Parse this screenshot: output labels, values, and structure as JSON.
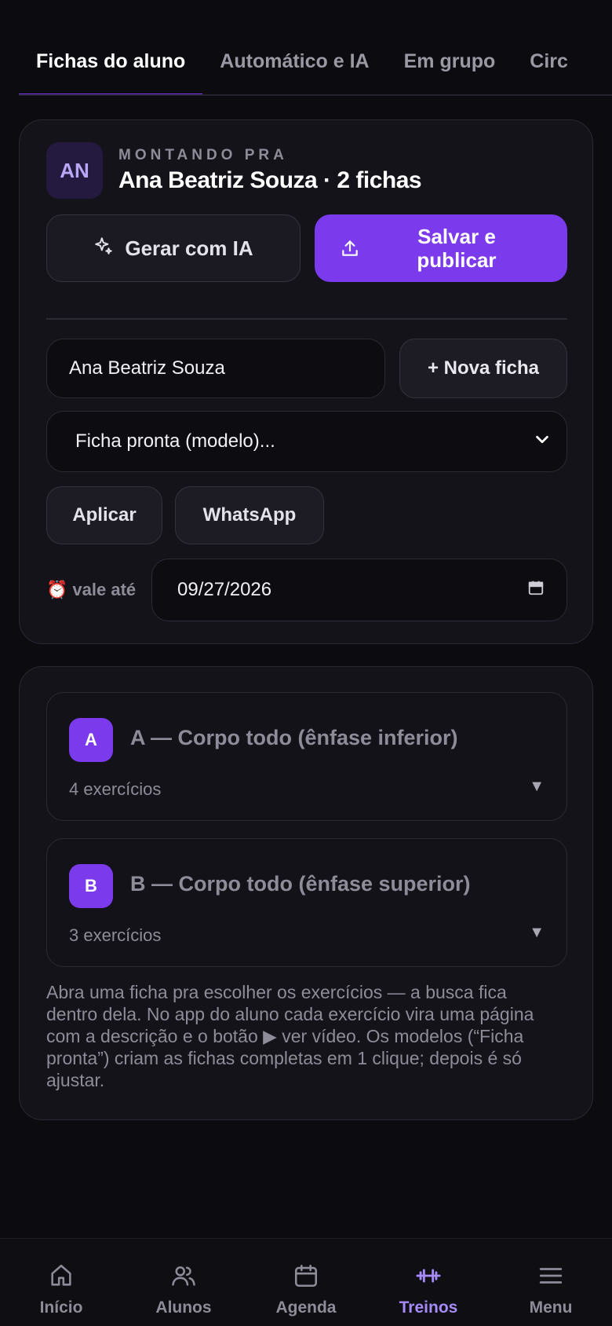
{
  "tabs": [
    {
      "label": "Fichas do aluno",
      "active": true
    },
    {
      "label": "Automático e IA",
      "active": false
    },
    {
      "label": "Em grupo",
      "active": false
    },
    {
      "label": "Circ",
      "active": false
    }
  ],
  "header": {
    "avatar_initials": "AN",
    "eyebrow": "MONTANDO PRA",
    "title": "Ana Beatriz Souza · 2 fichas"
  },
  "actions": {
    "ai_button": "Gerar com IA",
    "save_button": "Salvar e publicar"
  },
  "form": {
    "student_name_value": "Ana Beatriz Souza",
    "new_sheet_button": "+ Nova ficha",
    "template_select_value": "Ficha pronta (modelo)...",
    "apply_button": "Aplicar",
    "whatsapp_button": "WhatsApp",
    "valid_until_label": "vale até",
    "valid_until_icon": "⏰",
    "valid_until_value": "09/27/2026"
  },
  "sheets": [
    {
      "letter": "A",
      "title": "A — Corpo todo (ênfase inferior)",
      "count": "4 exercícios"
    },
    {
      "letter": "B",
      "title": "B — Corpo todo (ênfase superior)",
      "count": "3 exercícios"
    }
  ],
  "note": "Abra uma ficha pra escolher os exercícios — a busca fica dentro dela. No app do aluno cada exercício vira uma página com a descrição e o botão ▶ ver vídeo. Os modelos (“Ficha pronta”) criam as fichas completas em 1 clique; depois é só ajustar.",
  "bottom_nav": [
    {
      "label": "Início",
      "icon": "home-icon",
      "active": false
    },
    {
      "label": "Alunos",
      "icon": "users-icon",
      "active": false
    },
    {
      "label": "Agenda",
      "icon": "calendar-icon",
      "active": false
    },
    {
      "label": "Treinos",
      "icon": "dumbbell-icon",
      "active": true
    },
    {
      "label": "Menu",
      "icon": "menu-icon",
      "active": false
    }
  ],
  "colors": {
    "accent": "#7c3aed",
    "accent_light": "#a78bfa",
    "background": "#0c0b10",
    "card": "#14131a"
  }
}
